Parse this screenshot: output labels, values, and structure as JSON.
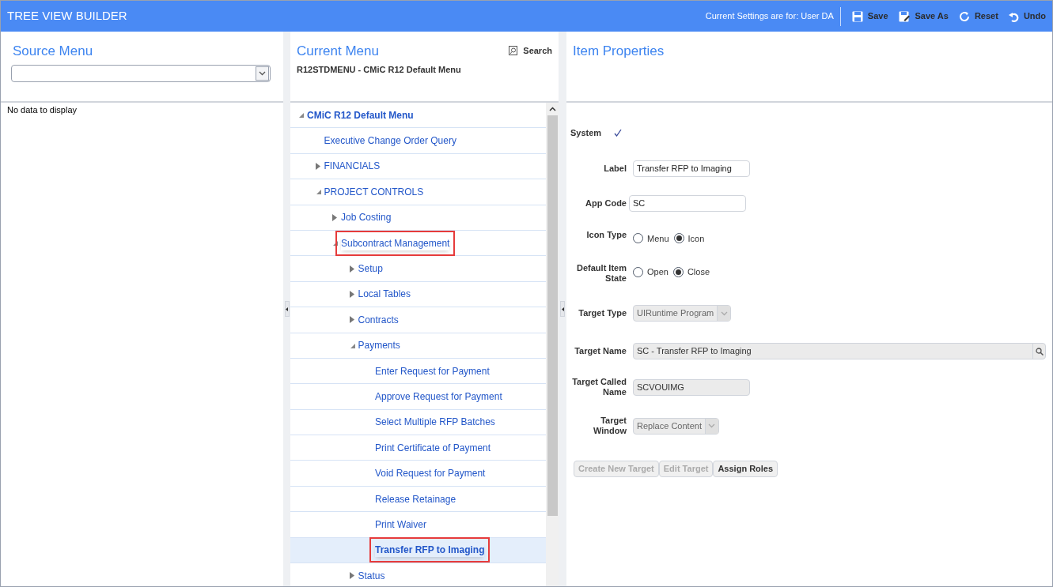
{
  "header": {
    "title": "TREE VIEW BUILDER",
    "settings_text": "Current Settings are for: User DA",
    "actions": [
      {
        "kind": "save",
        "label": "Save"
      },
      {
        "kind": "save_as",
        "label": "Save As"
      },
      {
        "kind": "reset",
        "label": "Reset"
      },
      {
        "kind": "undo",
        "label": "Undo"
      }
    ]
  },
  "source_menu": {
    "title": "Source Menu",
    "empty_text": "No data to display"
  },
  "current_menu": {
    "title": "Current Menu",
    "search_label": "Search",
    "subtitle": "R12STDMENU - CMiC R12 Default Menu",
    "tree": [
      {
        "label": "CMiC R12 Default Menu",
        "expanded": true,
        "selected": false,
        "highlighted": false,
        "children": [
          {
            "label": "Executive Change Order Query",
            "selected": false,
            "highlighted": false
          },
          {
            "label": "FINANCIALS",
            "expanded": false,
            "selected": false,
            "highlighted": false
          },
          {
            "label": "PROJECT CONTROLS",
            "expanded": true,
            "selected": false,
            "highlighted": false,
            "children": [
              {
                "label": "Job Costing",
                "expanded": false,
                "selected": false,
                "highlighted": false
              },
              {
                "label": "Subcontract Management",
                "expanded": true,
                "selected": false,
                "highlighted": true,
                "children": [
                  {
                    "label": "Setup",
                    "expanded": false,
                    "selected": false,
                    "highlighted": false
                  },
                  {
                    "label": "Local Tables",
                    "expanded": false,
                    "selected": false,
                    "highlighted": false
                  },
                  {
                    "label": "Contracts",
                    "expanded": false,
                    "selected": false,
                    "highlighted": false
                  },
                  {
                    "label": "Payments",
                    "expanded": true,
                    "selected": false,
                    "highlighted": false,
                    "children": [
                      {
                        "label": "Enter Request for Payment",
                        "selected": false,
                        "highlighted": false
                      },
                      {
                        "label": "Approve Request for Payment",
                        "selected": false,
                        "highlighted": false
                      },
                      {
                        "label": "Select Multiple RFP Batches",
                        "selected": false,
                        "highlighted": false
                      },
                      {
                        "label": "Print Certificate of Payment",
                        "selected": false,
                        "highlighted": false
                      },
                      {
                        "label": "Void Request for Payment",
                        "selected": false,
                        "highlighted": false
                      },
                      {
                        "label": "Release Retainage",
                        "selected": false,
                        "highlighted": false
                      },
                      {
                        "label": "Print Waiver",
                        "selected": false,
                        "highlighted": false
                      },
                      {
                        "label": "Transfer RFP to Imaging",
                        "selected": true,
                        "highlighted": true
                      }
                    ]
                  },
                  {
                    "label": "Status",
                    "expanded": false,
                    "selected": false,
                    "highlighted": false
                  }
                ]
              }
            ]
          }
        ]
      }
    ]
  },
  "item_properties": {
    "title": "Item Properties",
    "fields": [
      {
        "kind": "check",
        "label": "System",
        "checked": true
      },
      {
        "kind": "text",
        "label": "Label",
        "value": "Transfer RFP to Imaging",
        "disabled": false
      },
      {
        "kind": "text",
        "label": "App Code",
        "value": "SC",
        "disabled": false
      },
      {
        "kind": "radio",
        "label": "Icon Type",
        "options": [
          {
            "label": "Menu",
            "selected": false
          },
          {
            "label": "Icon",
            "selected": true
          }
        ]
      },
      {
        "kind": "radio",
        "label": "Default Item State",
        "options": [
          {
            "label": "Open",
            "selected": false
          },
          {
            "label": "Close",
            "selected": true
          }
        ]
      },
      {
        "kind": "select",
        "label": "Target Type",
        "value": "UIRuntime Program",
        "disabled": true
      },
      {
        "kind": "lookup",
        "label": "Target Name",
        "value": "SC - Transfer RFP to Imaging",
        "disabled": true
      },
      {
        "kind": "text",
        "label": "Target Called Name",
        "value": "SCVOUIMG",
        "disabled": true
      },
      {
        "kind": "select",
        "label": "Target Window",
        "value": "Replace Content",
        "disabled": true
      }
    ],
    "buttons": [
      {
        "label": "Create New Target",
        "disabled": true
      },
      {
        "label": "Edit Target",
        "disabled": true
      },
      {
        "label": "Assign Roles",
        "disabled": false
      }
    ]
  }
}
